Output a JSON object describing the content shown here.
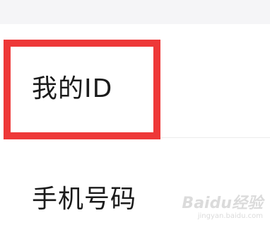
{
  "settings_list": {
    "items": [
      {
        "label": "我的ID"
      },
      {
        "label": "手机号码"
      }
    ]
  },
  "annotation": {
    "color": "#ee3838"
  },
  "watermark": {
    "logo": "Baidu经验",
    "url": "jingyan.baidu.com"
  }
}
